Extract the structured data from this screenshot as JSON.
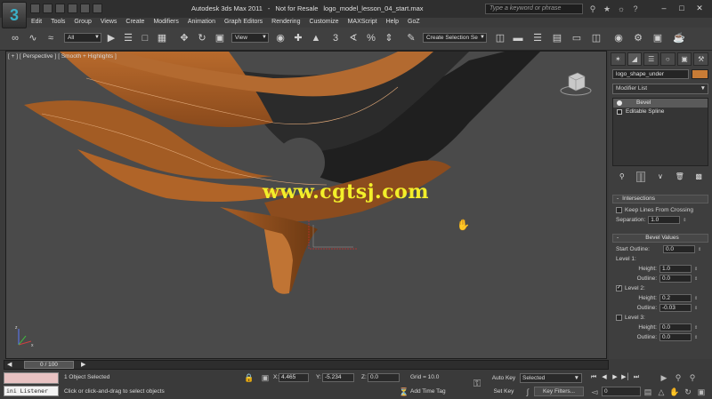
{
  "title_bar": {
    "app_name": "Autodesk 3ds Max  2011",
    "separator": "-",
    "license": "Not for Resale",
    "file_name": "logo_model_lesson_04_start.max",
    "search_placeholder": "Type a keyword or phrase"
  },
  "menu": {
    "items": [
      "Edit",
      "Tools",
      "Group",
      "Views",
      "Create",
      "Modifiers",
      "Animation",
      "Graph Editors",
      "Rendering",
      "Customize",
      "MAXScript",
      "Help",
      "GoZ"
    ]
  },
  "toolbar": {
    "selection_filter": "All",
    "reference_coord": "View",
    "snap_value": "3",
    "named_selection": "Create Selection Se"
  },
  "viewport": {
    "label_parts": [
      "[ + ]",
      "[ Perspective ]",
      "[ Smooth + Highlights ]"
    ],
    "watermark": "www.cgtsj.com"
  },
  "command_panel": {
    "object_name": "logo_shape_under",
    "object_color": "#c87c36",
    "modifier_list_label": "Modifier List",
    "stack": [
      "Bevel",
      "Editable Spline"
    ],
    "intersections": {
      "title": "Intersections",
      "keep_lines_label": "Keep Lines From Crossing",
      "keep_lines_checked": false,
      "separation_label": "Separation:",
      "separation_value": "1.0"
    },
    "bevel_values": {
      "title": "Bevel Values",
      "start_outline_label": "Start Outline:",
      "start_outline_value": "0.0",
      "level1_label": "Level 1:",
      "level1_height_label": "Height:",
      "level1_height_value": "1.0",
      "level1_outline_label": "Outline:",
      "level1_outline_value": "0.0",
      "level2_label": "Level 2:",
      "level2_checked": true,
      "level2_height_label": "Height:",
      "level2_height_value": "0.2",
      "level2_outline_label": "Outline:",
      "level2_outline_value": "-0.03",
      "level3_label": "Level 3:",
      "level3_checked": false,
      "level3_height_label": "Height:",
      "level3_height_value": "0.0",
      "level3_outline_label": "Outline:",
      "level3_outline_value": "0.0"
    }
  },
  "timeline": {
    "frame_display": "0 / 100"
  },
  "status_bar": {
    "listener_label": "ini Listener",
    "selection_status": "1 Object Selected",
    "prompt": "Click or click-and-drag to select objects",
    "x_label": "X:",
    "x_value": "4.465",
    "y_label": "Y:",
    "y_value": "-5.234",
    "z_label": "Z:",
    "z_value": "0.0",
    "grid": "Grid = 10.0",
    "add_time_tag": "Add Time Tag",
    "auto_key": "Auto Key",
    "set_key": "Set Key",
    "selected_dropdown": "Selected",
    "key_filters": "Key Filters...",
    "current_frame": "0"
  }
}
